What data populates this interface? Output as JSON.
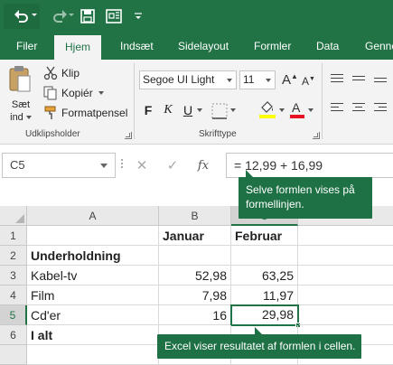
{
  "colors": {
    "brand": "#217346",
    "callout": "#1e7145",
    "ribbon": "#f3f3f3",
    "font_color_red": "#e81123",
    "highlight_yellow": "#ffff00"
  },
  "quick_access": [
    "undo-icon",
    "redo-icon",
    "save-icon",
    "present-icon",
    "customize-icon"
  ],
  "tabs": [
    "Filer",
    "Hjem",
    "Indsæt",
    "Sidelayout",
    "Formler",
    "Data",
    "Genne"
  ],
  "ribbon": {
    "clipboard": {
      "paste_line1": "Sæt",
      "paste_line2": "ind",
      "cut": "Klip",
      "copy": "Kopiér",
      "format_painter": "Formatpensel",
      "group_label": "Udklipsholder"
    },
    "font": {
      "font_name": "Segoe UI Light",
      "font_size": "11",
      "bold": "F",
      "italic": "K",
      "underline": "U",
      "group_label": "Skrifttype"
    }
  },
  "formula_bar": {
    "name_box": "C5",
    "cancel": "✕",
    "enter": "✓",
    "fx": "fx",
    "formula": "= 12,99 + 16,99"
  },
  "callouts": {
    "formula_note": "Selve formlen vises på formellinjen.",
    "result_note": "Excel viser resultatet af formlen i cellen."
  },
  "sheet": {
    "columns": [
      "A",
      "B",
      "C"
    ],
    "rows": [
      "1",
      "2",
      "3",
      "4",
      "5",
      "6"
    ],
    "selected_cell": "C5",
    "cells": {
      "B1": "Januar",
      "C1": "Februar",
      "A2": "Underholdning",
      "A3": "Kabel-tv",
      "B3": "52,98",
      "C3": "63,25",
      "A4": "Film",
      "B4": "7,98",
      "C4": "11,97",
      "A5": "Cd'er",
      "B5": "16",
      "C5": "29,98",
      "A6": "I alt"
    }
  }
}
